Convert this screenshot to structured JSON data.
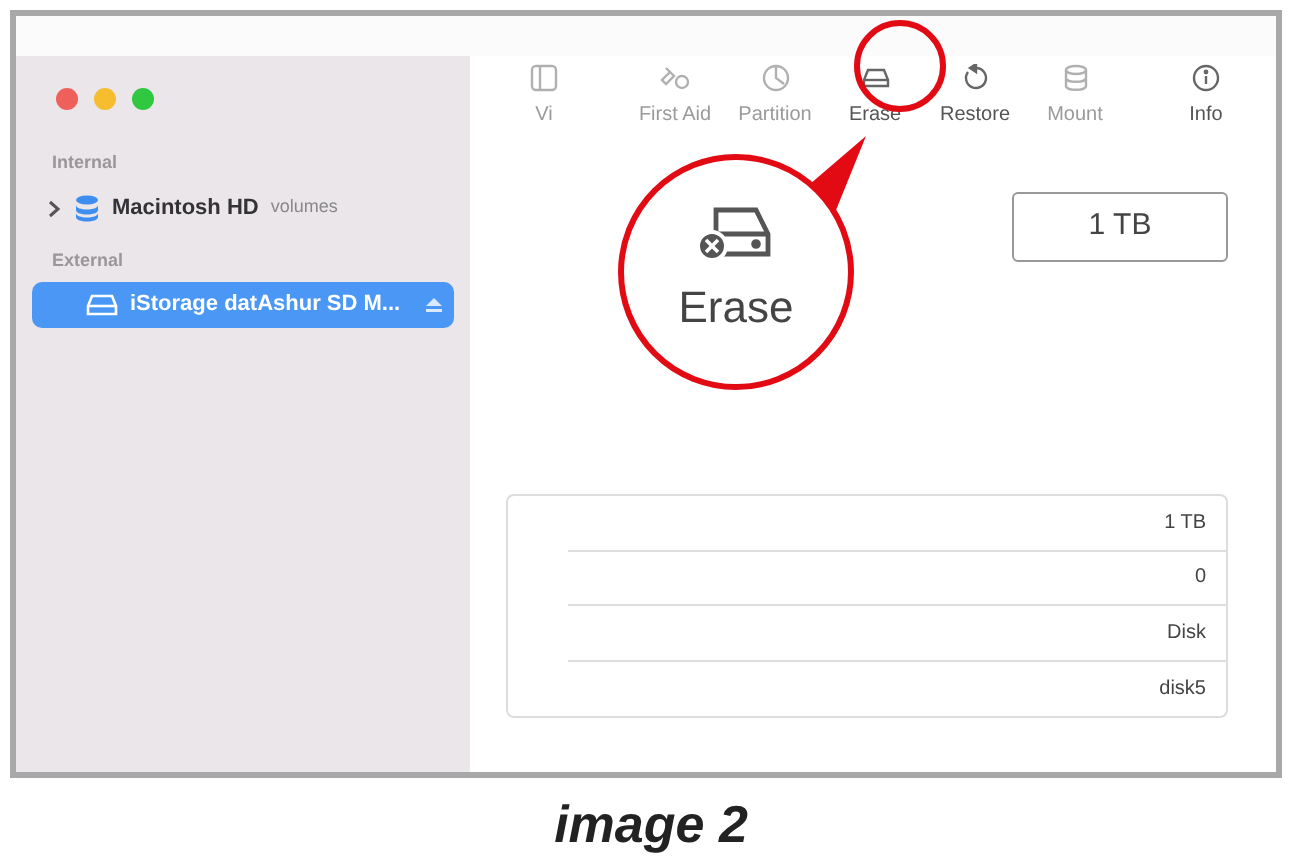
{
  "sidebar": {
    "sections": [
      {
        "heading": "Internal",
        "items": [
          {
            "name": "Macintosh HD",
            "detail": "volumes",
            "kind": "volume",
            "expandable": true,
            "selected": false
          }
        ]
      },
      {
        "heading": "External",
        "items": [
          {
            "name": "iStorage datAshur SD M...",
            "kind": "drive",
            "ejectable": true,
            "selected": true
          }
        ]
      }
    ]
  },
  "toolbar": [
    {
      "label": "Vi",
      "kind": "sidebar",
      "disabled": true
    },
    {
      "label": "First Aid",
      "kind": "firstaid",
      "disabled": true
    },
    {
      "label": "Partition",
      "kind": "partition",
      "disabled": true
    },
    {
      "label": "Erase",
      "kind": "erase",
      "disabled": false
    },
    {
      "label": "Restore",
      "kind": "restore",
      "disabled": false
    },
    {
      "label": "Mount",
      "kind": "mount",
      "disabled": true
    },
    {
      "label": "Info",
      "kind": "info",
      "disabled": false
    }
  ],
  "callout": {
    "label": "Erase"
  },
  "capacity": "1 TB",
  "info_rows": [
    "1 TB",
    "0",
    "Disk",
    "disk5"
  ],
  "caption": "image 2"
}
